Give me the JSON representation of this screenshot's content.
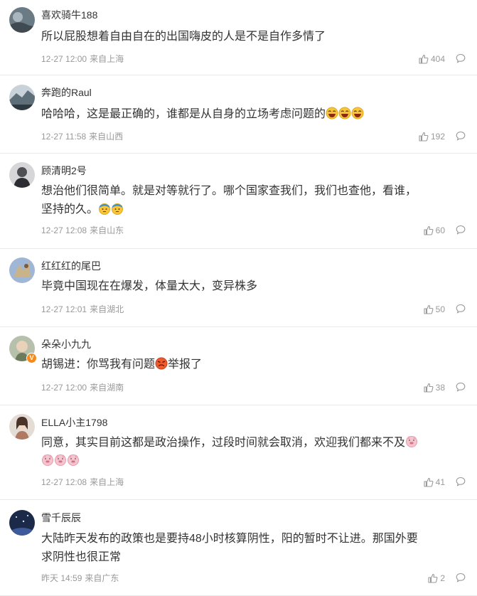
{
  "comments": [
    {
      "user": "喜欢骑牛188",
      "lines": [
        "所以屁股想着自由自在的出国嗨皮的人是不是自作多情了"
      ],
      "time": "12-27 12:00",
      "source": "来自上海",
      "likes": "404",
      "avatar_color": "#6b7b86",
      "verified": false
    },
    {
      "user": "奔跑的Raul",
      "lines": [
        "哈哈哈，这是最正确的，谁都是从自身的立场考虑问题的"
      ],
      "time": "12-27 11:58",
      "source": "来自山西",
      "likes": "192",
      "avatar_color": "#8a9aa3",
      "verified": false,
      "emojis": [
        "laugh-emoji",
        "laugh-emoji",
        "laugh-emoji"
      ]
    },
    {
      "user": "顾清明2号",
      "lines": [
        "想治他们很简单。就是对等就行了。哪个国家查我们，我们也查他，看谁，",
        "坚持的久。"
      ],
      "time": "12-27 12:08",
      "source": "来自山东",
      "likes": "60",
      "avatar_color": "#4d4f55",
      "verified": false,
      "emojis": [
        "sweat-emoji",
        "sweat-emoji"
      ]
    },
    {
      "user": "红红红的尾巴",
      "lines": [
        "毕竟中国现在在爆发，体量太大，变异株多"
      ],
      "time": "12-27 12:01",
      "source": "来自湖北",
      "likes": "50",
      "avatar_color": "#7d93b8",
      "verified": false
    },
    {
      "user": "朵朵小九九",
      "lines": [
        "胡锡进：你骂我有问题",
        "举报了"
      ],
      "time": "12-27 12:00",
      "source": "来自湖南",
      "likes": "38",
      "avatar_color": "#9aa58f",
      "verified": true,
      "emojis": [
        "angry-emoji"
      ]
    },
    {
      "user": "ELLA小主1798",
      "lines": [
        "同意，其实目前这都是政治操作，过段时间就会取消，欢迎我们都来不及",
        ""
      ],
      "time": "12-27 12:08",
      "source": "来自上海",
      "likes": "41",
      "avatar_color": "#a58f7e",
      "verified": false,
      "emojis": [
        "pig-emoji",
        "pig-emoji",
        "pig-emoji",
        "pig-emoji"
      ]
    },
    {
      "user": "雪千辰辰",
      "lines": [
        "大陆昨天发布的政策也是要持48小时核算阴性，阳的暂时不让进。那国外要",
        "求阴性也很正常"
      ],
      "time": "昨天 14:59",
      "source": "来自广东",
      "likes": "2",
      "avatar_color": "#1c2a4a",
      "verified": false
    }
  ],
  "colors": {
    "text": "#333333",
    "meta": "#999999",
    "divider": "#e9e9e9",
    "verified_badge": "#f58b1f"
  },
  "icons": {
    "like": "thumbs-up-icon",
    "reply": "comment-bubble-icon",
    "verified": "v-badge-icon"
  }
}
